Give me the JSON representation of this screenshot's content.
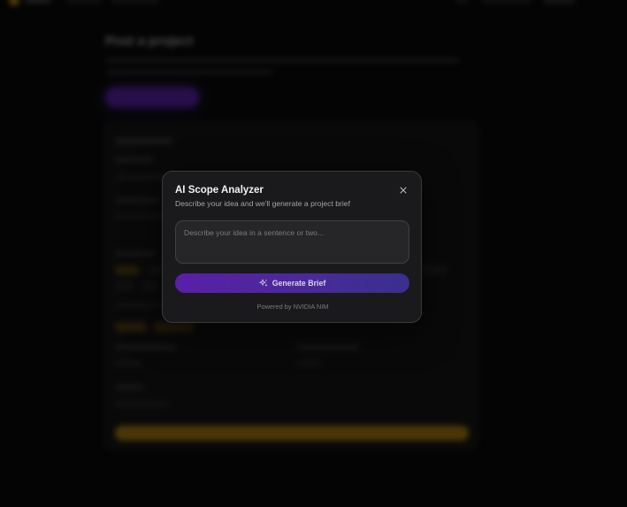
{
  "modal": {
    "title": "AI Scope Analyzer",
    "subtitle": "Describe your idea and we'll generate a project brief",
    "input_placeholder": "Describe your idea in a sentence or two...",
    "input_value": "",
    "generate_label": "Generate Brief",
    "footer": "Powered by NVIDIA NIM",
    "close_icon": "close-icon",
    "generate_icon": "sparkles-icon"
  },
  "background": {
    "page_title": "Post a project",
    "colors": {
      "accent_gold": "#d49a1c",
      "accent_purple": "#5e22b8"
    }
  },
  "colors": {
    "modal_bg": "#1a1a1c",
    "button_gradient_start": "#5a1fa8",
    "button_gradient_end": "#3a2f8e"
  }
}
